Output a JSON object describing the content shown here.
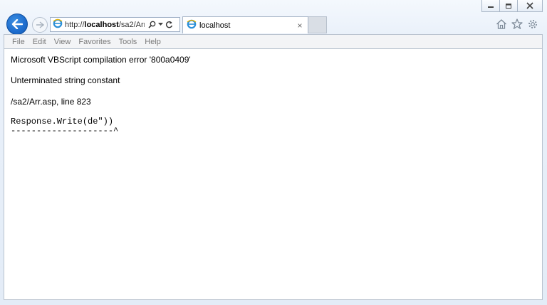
{
  "browser": {
    "address_prefix": "http://",
    "address_host": "localhost",
    "address_path": "/sa2/Arr",
    "tab_title": "localhost",
    "tab_close": "×"
  },
  "menu": [
    "File",
    "Edit",
    "View",
    "Favorites",
    "Tools",
    "Help"
  ],
  "page": {
    "error_title": "Microsoft VBScript compilation error '800a0409'",
    "error_message": "Unterminated string constant",
    "error_location": "/sa2/Arr.asp, line 823",
    "code_line": "Response.Write(de\"))",
    "pointer_line": "--------------------^"
  },
  "icons": {
    "back": "back-arrow-icon",
    "forward": "forward-arrow-icon",
    "search": "search-icon",
    "refresh": "refresh-icon",
    "home": "home-icon",
    "favorites": "star-icon",
    "tools": "gear-icon"
  },
  "colors": {
    "accent": "#1f6fd0",
    "menu_text": "#7a7a7a"
  }
}
